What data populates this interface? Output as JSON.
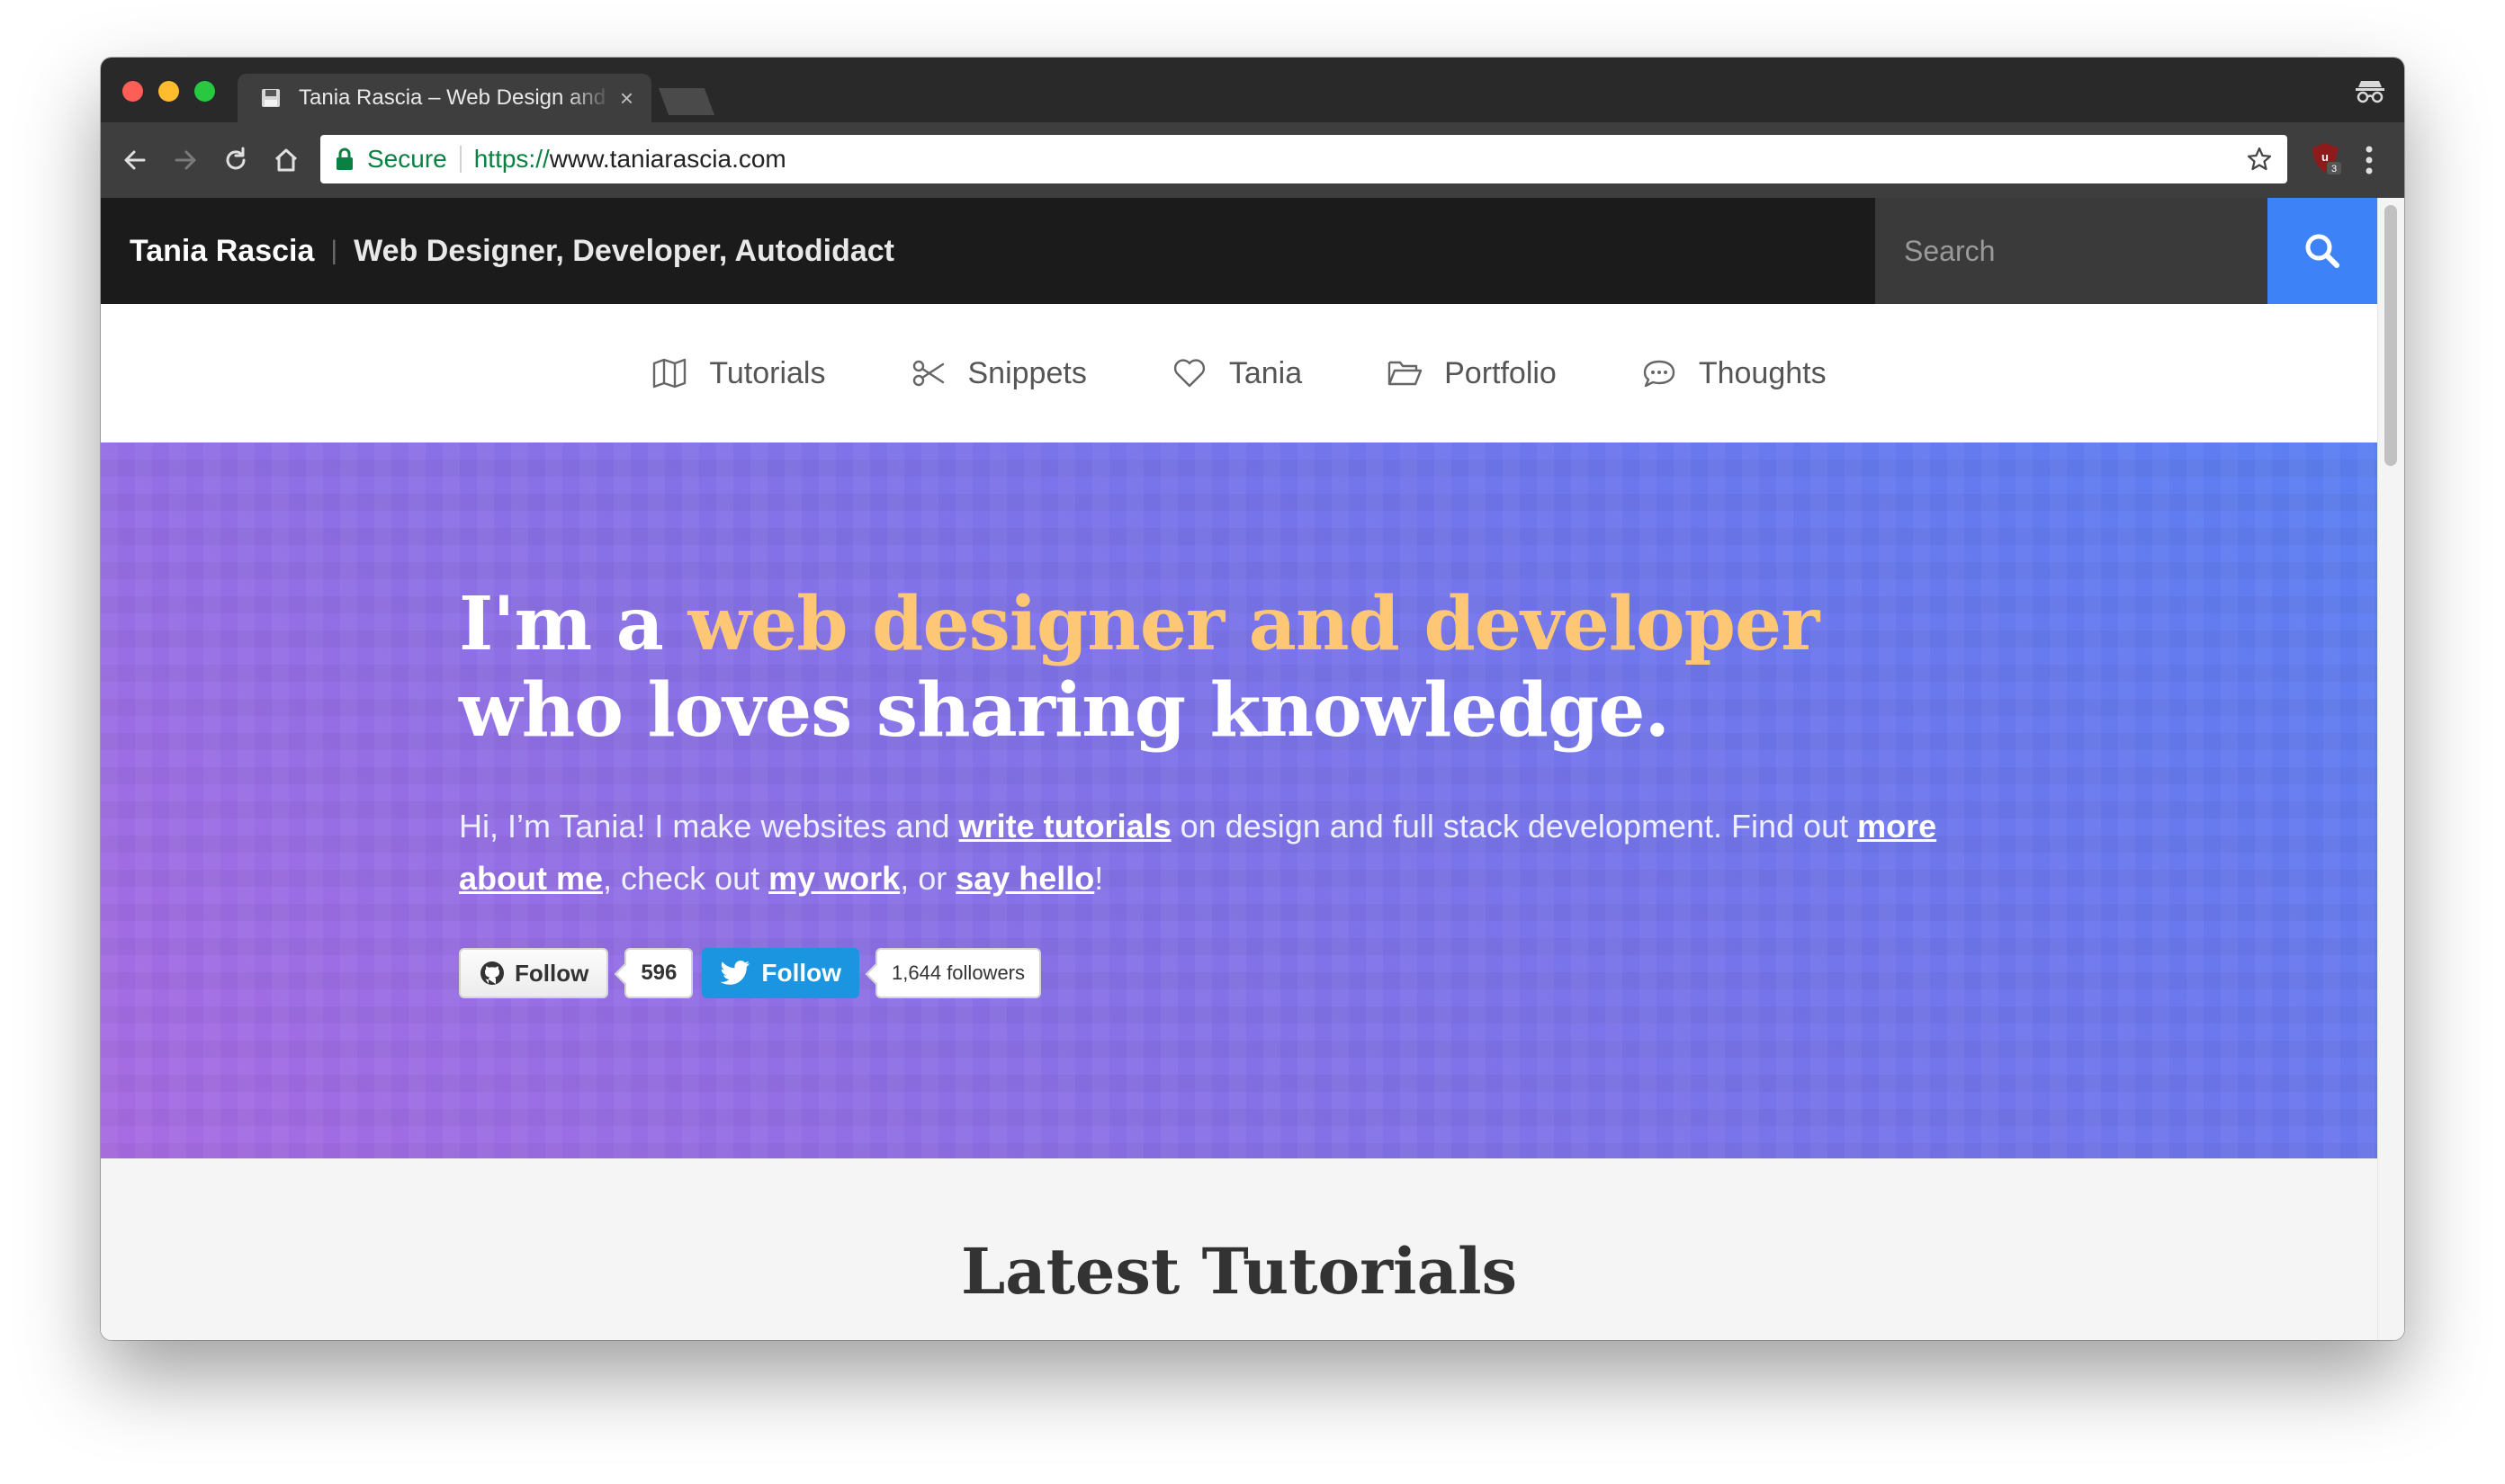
{
  "browser": {
    "tab_title": "Tania Rascia – Web Design and Development",
    "omnibox": {
      "security_label": "Secure",
      "url_scheme": "https://",
      "url_host": "www.taniarascia.com"
    },
    "extension_badge": "3"
  },
  "site": {
    "name": "Tania Rascia",
    "separator": "|",
    "tagline": "Web Designer, Developer, Autodidact",
    "search_placeholder": "Search"
  },
  "nav": {
    "items": [
      {
        "label": "Tutorials",
        "icon": "map-icon"
      },
      {
        "label": "Snippets",
        "icon": "scissors-icon"
      },
      {
        "label": "Tania",
        "icon": "heart-icon"
      },
      {
        "label": "Portfolio",
        "icon": "folder-icon"
      },
      {
        "label": "Thoughts",
        "icon": "speech-bubble-icon"
      }
    ]
  },
  "hero": {
    "heading_start": "I'm a ",
    "heading_accent": "web designer and developer",
    "heading_end": " who loves sharing knowledge.",
    "intro_1": "Hi, I’m Tania! I make websites and ",
    "link_write_tutorials": "write tutorials",
    "intro_2": " on design and full stack development. Find out ",
    "link_more_about_me": "more about me",
    "intro_3": ", check out ",
    "link_my_work": "my work",
    "intro_4": ", or ",
    "link_say_hello": "say hello",
    "intro_5": "!",
    "github_follow_label": "Follow",
    "github_count": "596",
    "twitter_follow_label": "Follow",
    "twitter_followers": "1,644 followers"
  },
  "latest": {
    "title": "Latest Tutorials"
  },
  "colors": {
    "accent_yellow": "#fdc775",
    "search_blue": "#3e82f7",
    "twitter_blue": "#1b95e0",
    "header_black": "#1b1b1b"
  }
}
